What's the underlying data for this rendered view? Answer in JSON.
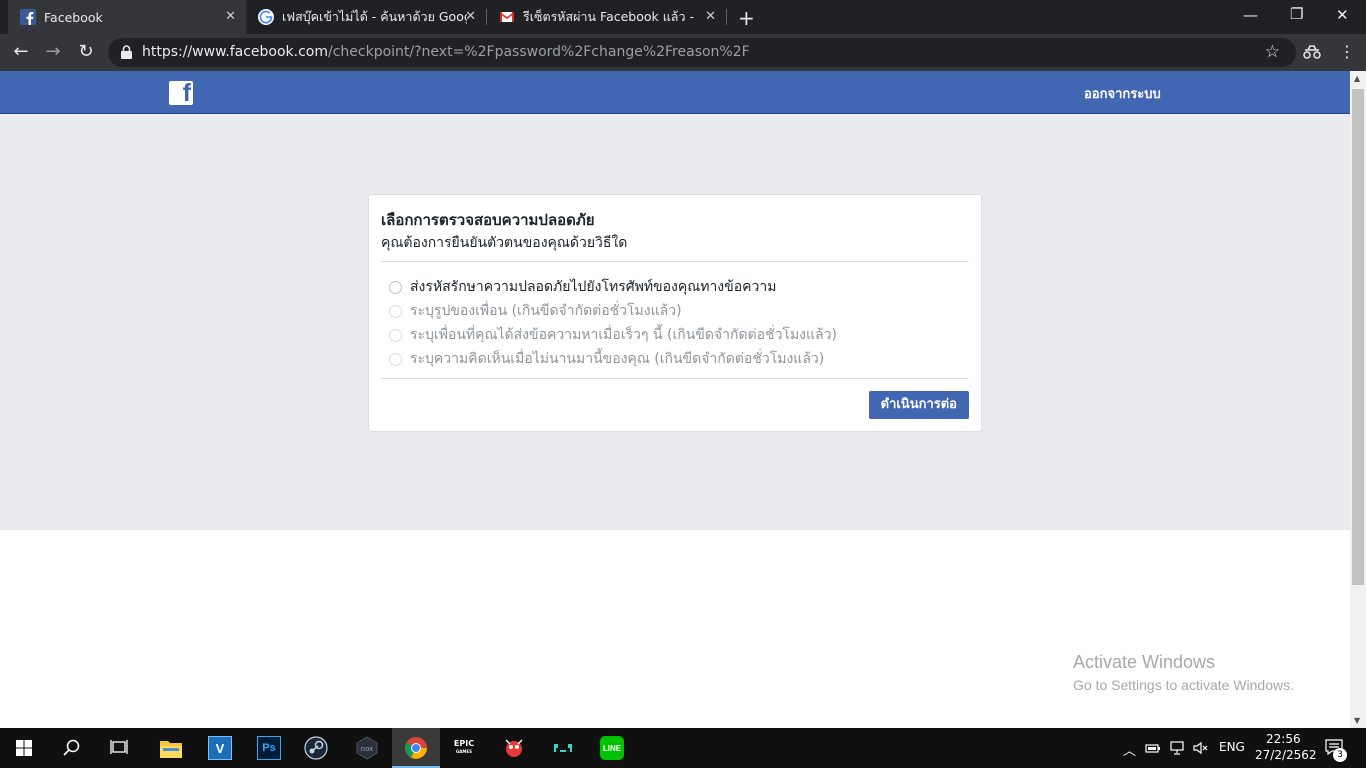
{
  "tabs": [
    {
      "title": "Facebook",
      "icon": "facebook-favicon-icon",
      "active": true
    },
    {
      "title": "เฟสบุ๊คเข้าไม่ได้ - ค้นหาด้วย Google",
      "icon": "google-favicon-icon",
      "active": false
    },
    {
      "title": "รีเซ็ตรหัสผ่าน Facebook แล้ว - chick",
      "icon": "gmail-favicon-icon",
      "active": false
    }
  ],
  "address_bar": {
    "host": "https://www.facebook.com",
    "path": "/checkpoint/?next=%2Fpassword%2Fchange%2Freason%2F"
  },
  "fb_header": {
    "logout_label": "ออกจากระบบ",
    "brand_color": "#4267b2"
  },
  "checkpoint": {
    "title": "เลือกการตรวจสอบความปลอดภัย",
    "subtitle": "คุณต้องการยืนยันตัวตนของคุณด้วยวิธีใด",
    "options": [
      {
        "label": "ส่งรหัสรักษาความปลอดภัยไปยังโทรศัพท์ของคุณทางข้อความ",
        "enabled": true
      },
      {
        "label": "ระบุรูปของเพื่อน (เกินขีดจำกัดต่อชั่วโมงแล้ว)",
        "enabled": false
      },
      {
        "label": "ระบุเพื่อนที่คุณได้ส่งข้อความหาเมื่อเร็วๆ นี้ (เกินขีดจำกัดต่อชั่วโมงแล้ว)",
        "enabled": false
      },
      {
        "label": "ระบุความคิดเห็นเมื่อไม่นานมานี้ของคุณ (เกินขีดจำกัดต่อชั่วโมงแล้ว)",
        "enabled": false
      }
    ],
    "continue_label": "ดำเนินการต่อ"
  },
  "watermark": {
    "line1": "Activate Windows",
    "line2": "Go to Settings to activate Windows."
  },
  "taskbar": {
    "language": "ENG",
    "time": "22:56",
    "date": "27/2/2562",
    "notification_count": "3",
    "epic_label": "EPIC"
  }
}
